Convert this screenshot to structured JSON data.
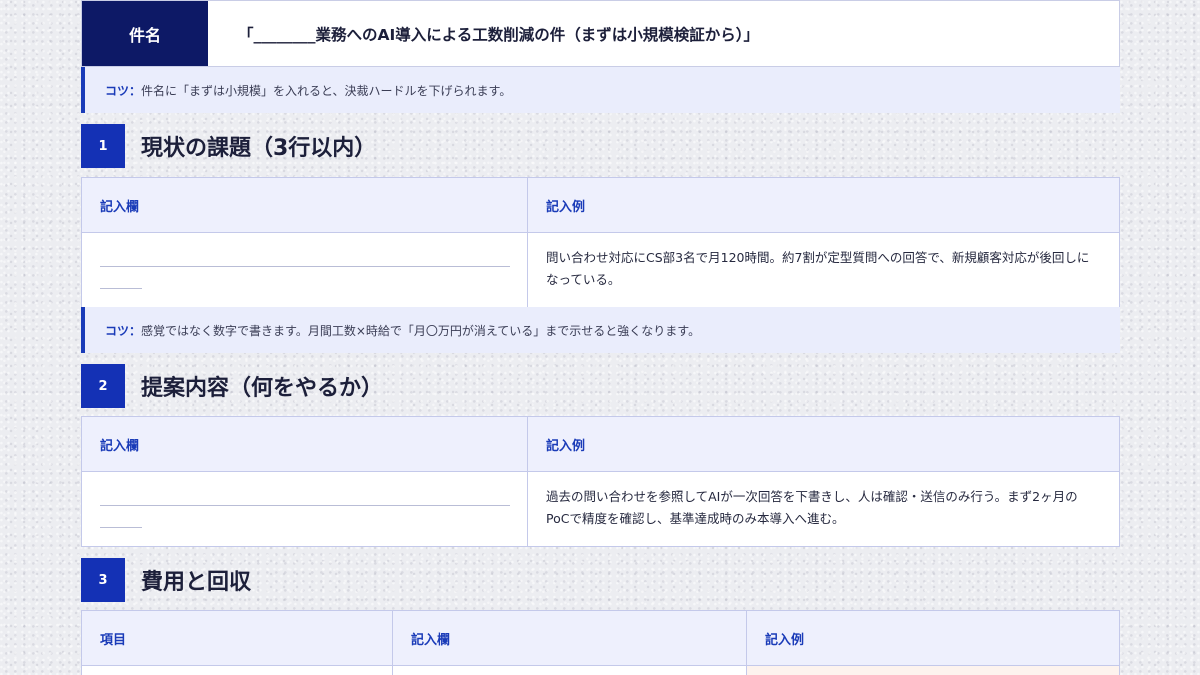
{
  "subject": {
    "label": "件名",
    "value": "「________業務へのAI導入による工数削減の件（まずは小規模検証から）」"
  },
  "tip1": {
    "label": "コツ：",
    "text": "件名に「まずは小規模」を入れると、決裁ハードルを下げられます。"
  },
  "section1": {
    "number": "1",
    "title": "現状の課題（3行以内）",
    "col_write": "記入欄",
    "col_example": "記入例",
    "example": "問い合わせ対応にCS部3名で月120時間。約7割が定型質問への回答で、新規顧客対応が後回しになっている。"
  },
  "tip2": {
    "label": "コツ：",
    "text": "感覚ではなく数字で書きます。月間工数×時給で「月〇万円が消えている」まで示せると強くなります。"
  },
  "section2": {
    "number": "2",
    "title": "提案内容（何をやるか）",
    "col_write": "記入欄",
    "col_example": "記入例",
    "example": "過去の問い合わせを参照してAIが一次回答を下書きし、人は確認・送信のみ行う。まず2ヶ月のPoCで精度を確認し、基準達成時のみ本導入へ進む。"
  },
  "section3": {
    "number": "3",
    "title": "費用と回収",
    "col_item": "項目",
    "col_write": "記入欄",
    "col_example": "記入例"
  }
}
